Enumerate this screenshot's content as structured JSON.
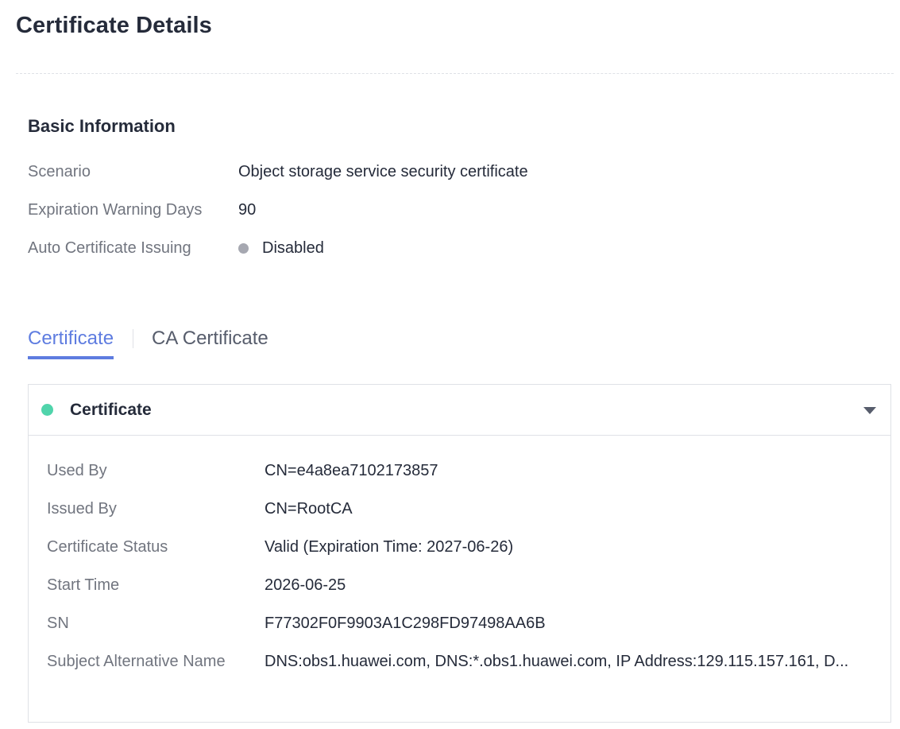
{
  "page": {
    "title": "Certificate Details"
  },
  "basic_info": {
    "title": "Basic Information",
    "rows": [
      {
        "label": "Scenario",
        "value": "Object storage service security certificate"
      },
      {
        "label": "Expiration Warning Days",
        "value": "90"
      },
      {
        "label": "Auto Certificate Issuing",
        "value": "Disabled",
        "status_color": "#a6a8b1",
        "icon": "status-dot-icon"
      }
    ]
  },
  "tabs": [
    {
      "label": "Certificate",
      "active": true
    },
    {
      "label": "CA Certificate",
      "active": false
    }
  ],
  "certificate_card": {
    "title": "Certificate",
    "status_color": "#50d4ab",
    "icon": "caret-down-icon",
    "rows": [
      {
        "label": "Used By",
        "value": "CN=e4a8ea7102173857"
      },
      {
        "label": "Issued By",
        "value": "CN=RootCA"
      },
      {
        "label": "Certificate Status",
        "value": "Valid (Expiration Time: 2027-06-26)"
      },
      {
        "label": "Start Time",
        "value": "2026-06-25"
      },
      {
        "label": "SN",
        "value": "F77302F0F9903A1C298FD97498AA6B"
      },
      {
        "label": "Subject Alternative Name",
        "value": "DNS:obs1.huawei.com, DNS:*.obs1.huawei.com, IP Address:129.115.157.161, D..."
      }
    ]
  },
  "colors": {
    "accent": "#5e7ce0",
    "text": "#252b3a",
    "label": "#71757f",
    "border": "#dfe1e6"
  }
}
